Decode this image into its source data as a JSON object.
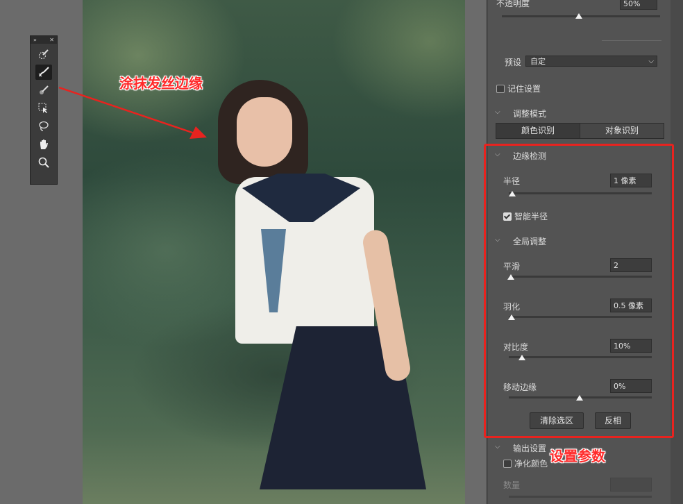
{
  "canvas": {
    "annotation_left": "涂抹发丝边缘",
    "annotation_right": "设置参数"
  },
  "toolbox": {
    "collapse_glyph": "»",
    "close_glyph": "✕",
    "tools": [
      {
        "name": "quick-selection-icon",
        "active": false
      },
      {
        "name": "refine-edge-brush-icon",
        "active": true
      },
      {
        "name": "brush-icon",
        "active": false
      },
      {
        "name": "object-selection-icon",
        "active": false
      },
      {
        "name": "lasso-icon",
        "active": false
      },
      {
        "name": "hand-icon",
        "active": false
      },
      {
        "name": "zoom-icon",
        "active": false
      }
    ]
  },
  "panel": {
    "opacity_label": "不透明度",
    "opacity_value": "50%",
    "preset_label": "预设",
    "preset_value": "自定",
    "remember_label": "记住设置",
    "adjust_mode_label": "调整模式",
    "mode_color": "颜色识别",
    "mode_object": "对象识别",
    "edge_detection_label": "边缘检测",
    "radius_label": "半径",
    "radius_value": "1 像素",
    "smart_radius_label": "智能半径",
    "global_adjust_label": "全局调整",
    "smooth_label": "平滑",
    "smooth_value": "2",
    "feather_label": "羽化",
    "feather_value": "0.5 像素",
    "contrast_label": "对比度",
    "contrast_value": "10%",
    "shift_edge_label": "移动边缘",
    "shift_edge_value": "0%",
    "clear_selection_label": "清除选区",
    "invert_label": "反相",
    "output_label": "输出设置",
    "decontaminate_label": "净化颜色",
    "amount_label": "数量"
  },
  "colors": {
    "annotation": "#ff2a2a",
    "panel_bg": "#535353",
    "highlight_box": "#e8231f"
  }
}
